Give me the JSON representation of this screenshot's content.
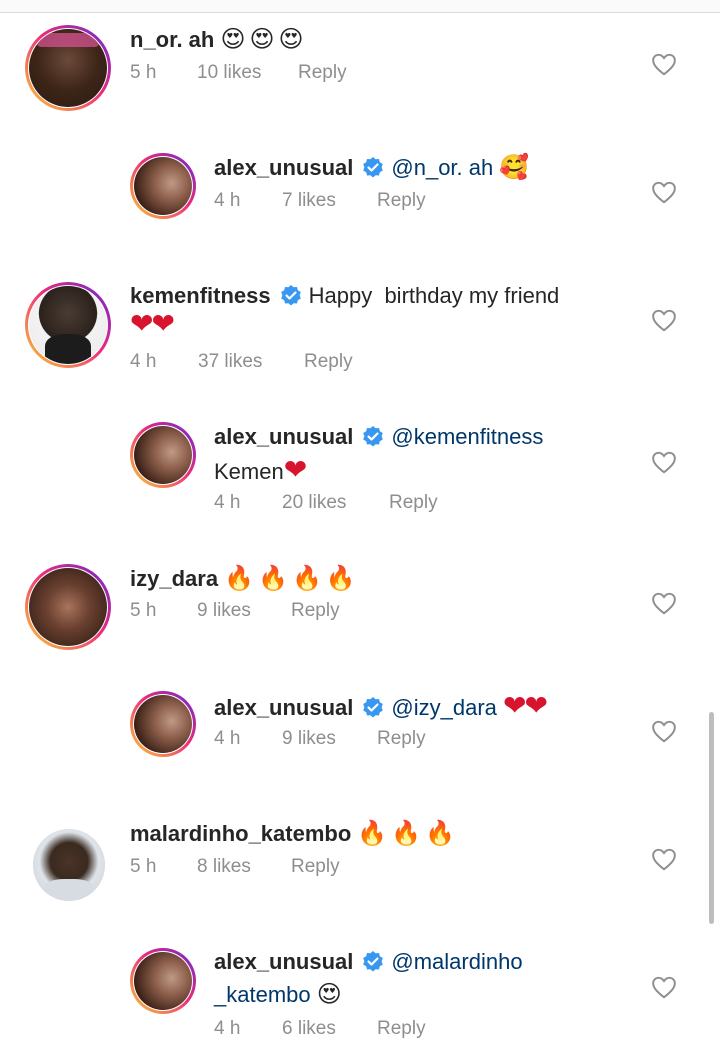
{
  "comments": [
    {
      "username": "n_or. ah",
      "emoji": "😍😍😍",
      "time": "5 h",
      "likes": "10 likes",
      "reply": "Reply"
    },
    {
      "username": "alex_unusual",
      "mention": "@n_or. ah",
      "emoji": "🥰",
      "time": "4 h",
      "likes": "7 likes",
      "reply": "Reply"
    },
    {
      "username": "kemenfitness",
      "text": "Happy  birthday my friend",
      "emoji": "❤❤",
      "time": "4 h",
      "likes": "37 likes",
      "reply": "Reply"
    },
    {
      "username": "alex_unusual",
      "mention": "@kemenfitness",
      "text": "Kemen",
      "emoji": "❤",
      "time": "4 h",
      "likes": "20 likes",
      "reply": "Reply"
    },
    {
      "username": "izy_dara",
      "emoji": "🔥🔥🔥🔥",
      "time": "5 h",
      "likes": "9 likes",
      "reply": "Reply"
    },
    {
      "username": "alex_unusual",
      "mention": "@izy_dara",
      "emoji": "❤❤",
      "time": "4 h",
      "likes": "9 likes",
      "reply": "Reply"
    },
    {
      "username": "malardinho_katembo",
      "emoji": "🔥🔥🔥",
      "time": "5 h",
      "likes": "8 likes",
      "reply": "Reply"
    },
    {
      "username": "alex_unusual",
      "mention": "@malardinho",
      "mention_cont": "_katembo",
      "emoji": "😍",
      "time": "4 h",
      "likes": "6 likes",
      "reply": "Reply"
    }
  ]
}
